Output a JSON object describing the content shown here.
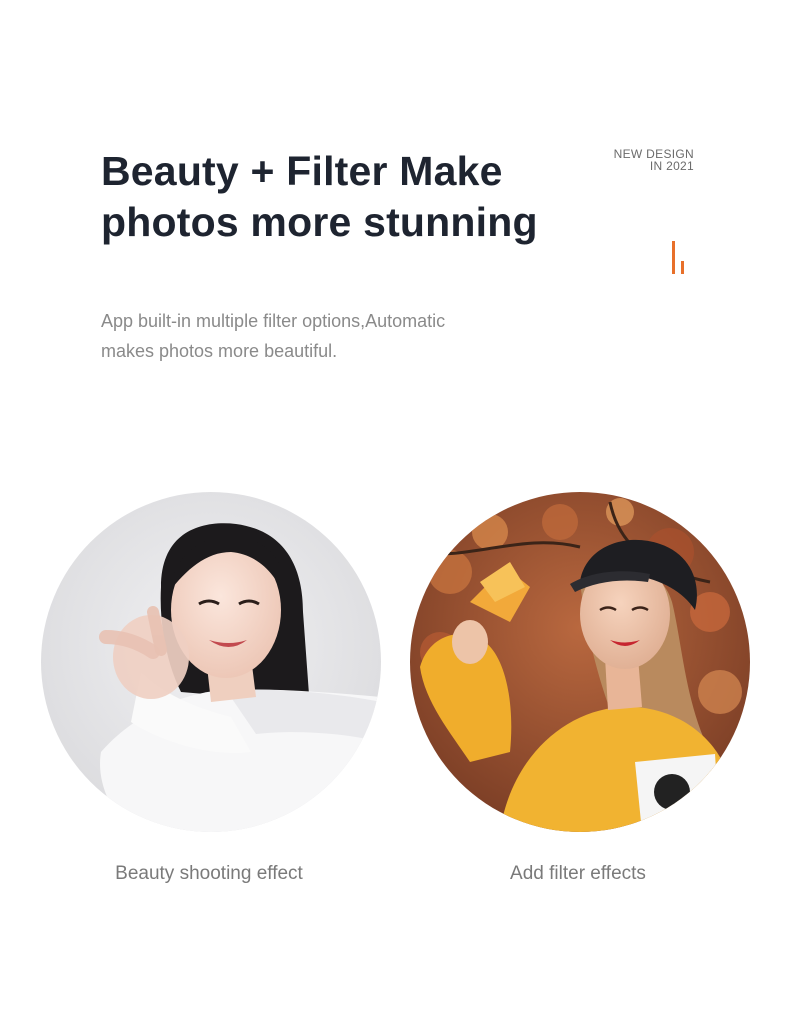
{
  "headline": {
    "line1": "Beauty + Filter Make",
    "line2": "photos more stunning"
  },
  "badge": {
    "line1": "NEW DESIGN",
    "line2": "IN 2021"
  },
  "description": {
    "line1": "App built-in multiple filter options,Automatic",
    "line2": "makes photos more beautiful."
  },
  "features": [
    {
      "caption": "Beauty shooting effect",
      "image": "woman-finger-heart-photo"
    },
    {
      "caption": "Add filter effects",
      "image": "woman-autumn-leaves-photo"
    }
  ],
  "colors": {
    "accent": "#e8702a",
    "headline": "#1e2430",
    "body_text": "#8a8a8a"
  }
}
